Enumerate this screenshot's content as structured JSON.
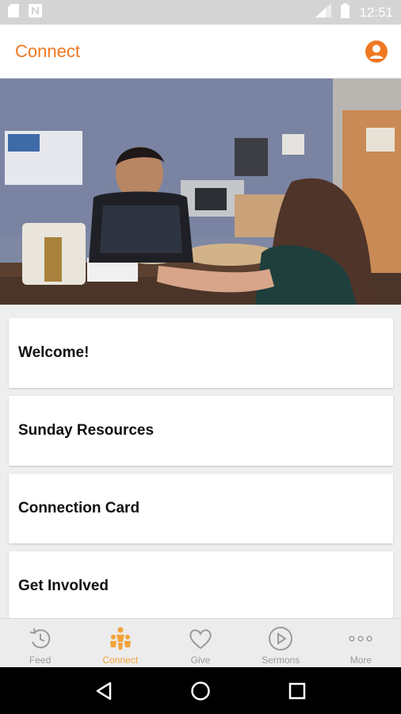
{
  "status_bar": {
    "time": "12:51",
    "icons": [
      "sd-card-icon",
      "n-notification-icon",
      "signal-icon",
      "battery-icon"
    ]
  },
  "app_bar": {
    "title": "Connect",
    "profile_icon": "person-circle-icon"
  },
  "hero": {
    "image_description": "woman serving food at counter to girl"
  },
  "list": {
    "items": [
      {
        "label": "Welcome!"
      },
      {
        "label": "Sunday Resources"
      },
      {
        "label": "Connection Card"
      },
      {
        "label": "Get Involved"
      }
    ]
  },
  "tabs": {
    "items": [
      {
        "label": "Feed",
        "icon": "history-icon"
      },
      {
        "label": "Connect",
        "icon": "people-icon",
        "active": true
      },
      {
        "label": "Give",
        "icon": "heart-icon"
      },
      {
        "label": "Sermons",
        "icon": "play-circle-icon"
      },
      {
        "label": "More",
        "icon": "more-dots-icon"
      }
    ]
  },
  "colors": {
    "accent": "#f07722",
    "tab_active": "#f2a33a",
    "tab_inactive": "#9b9b9b",
    "status_bar": "#d4d4d4"
  }
}
